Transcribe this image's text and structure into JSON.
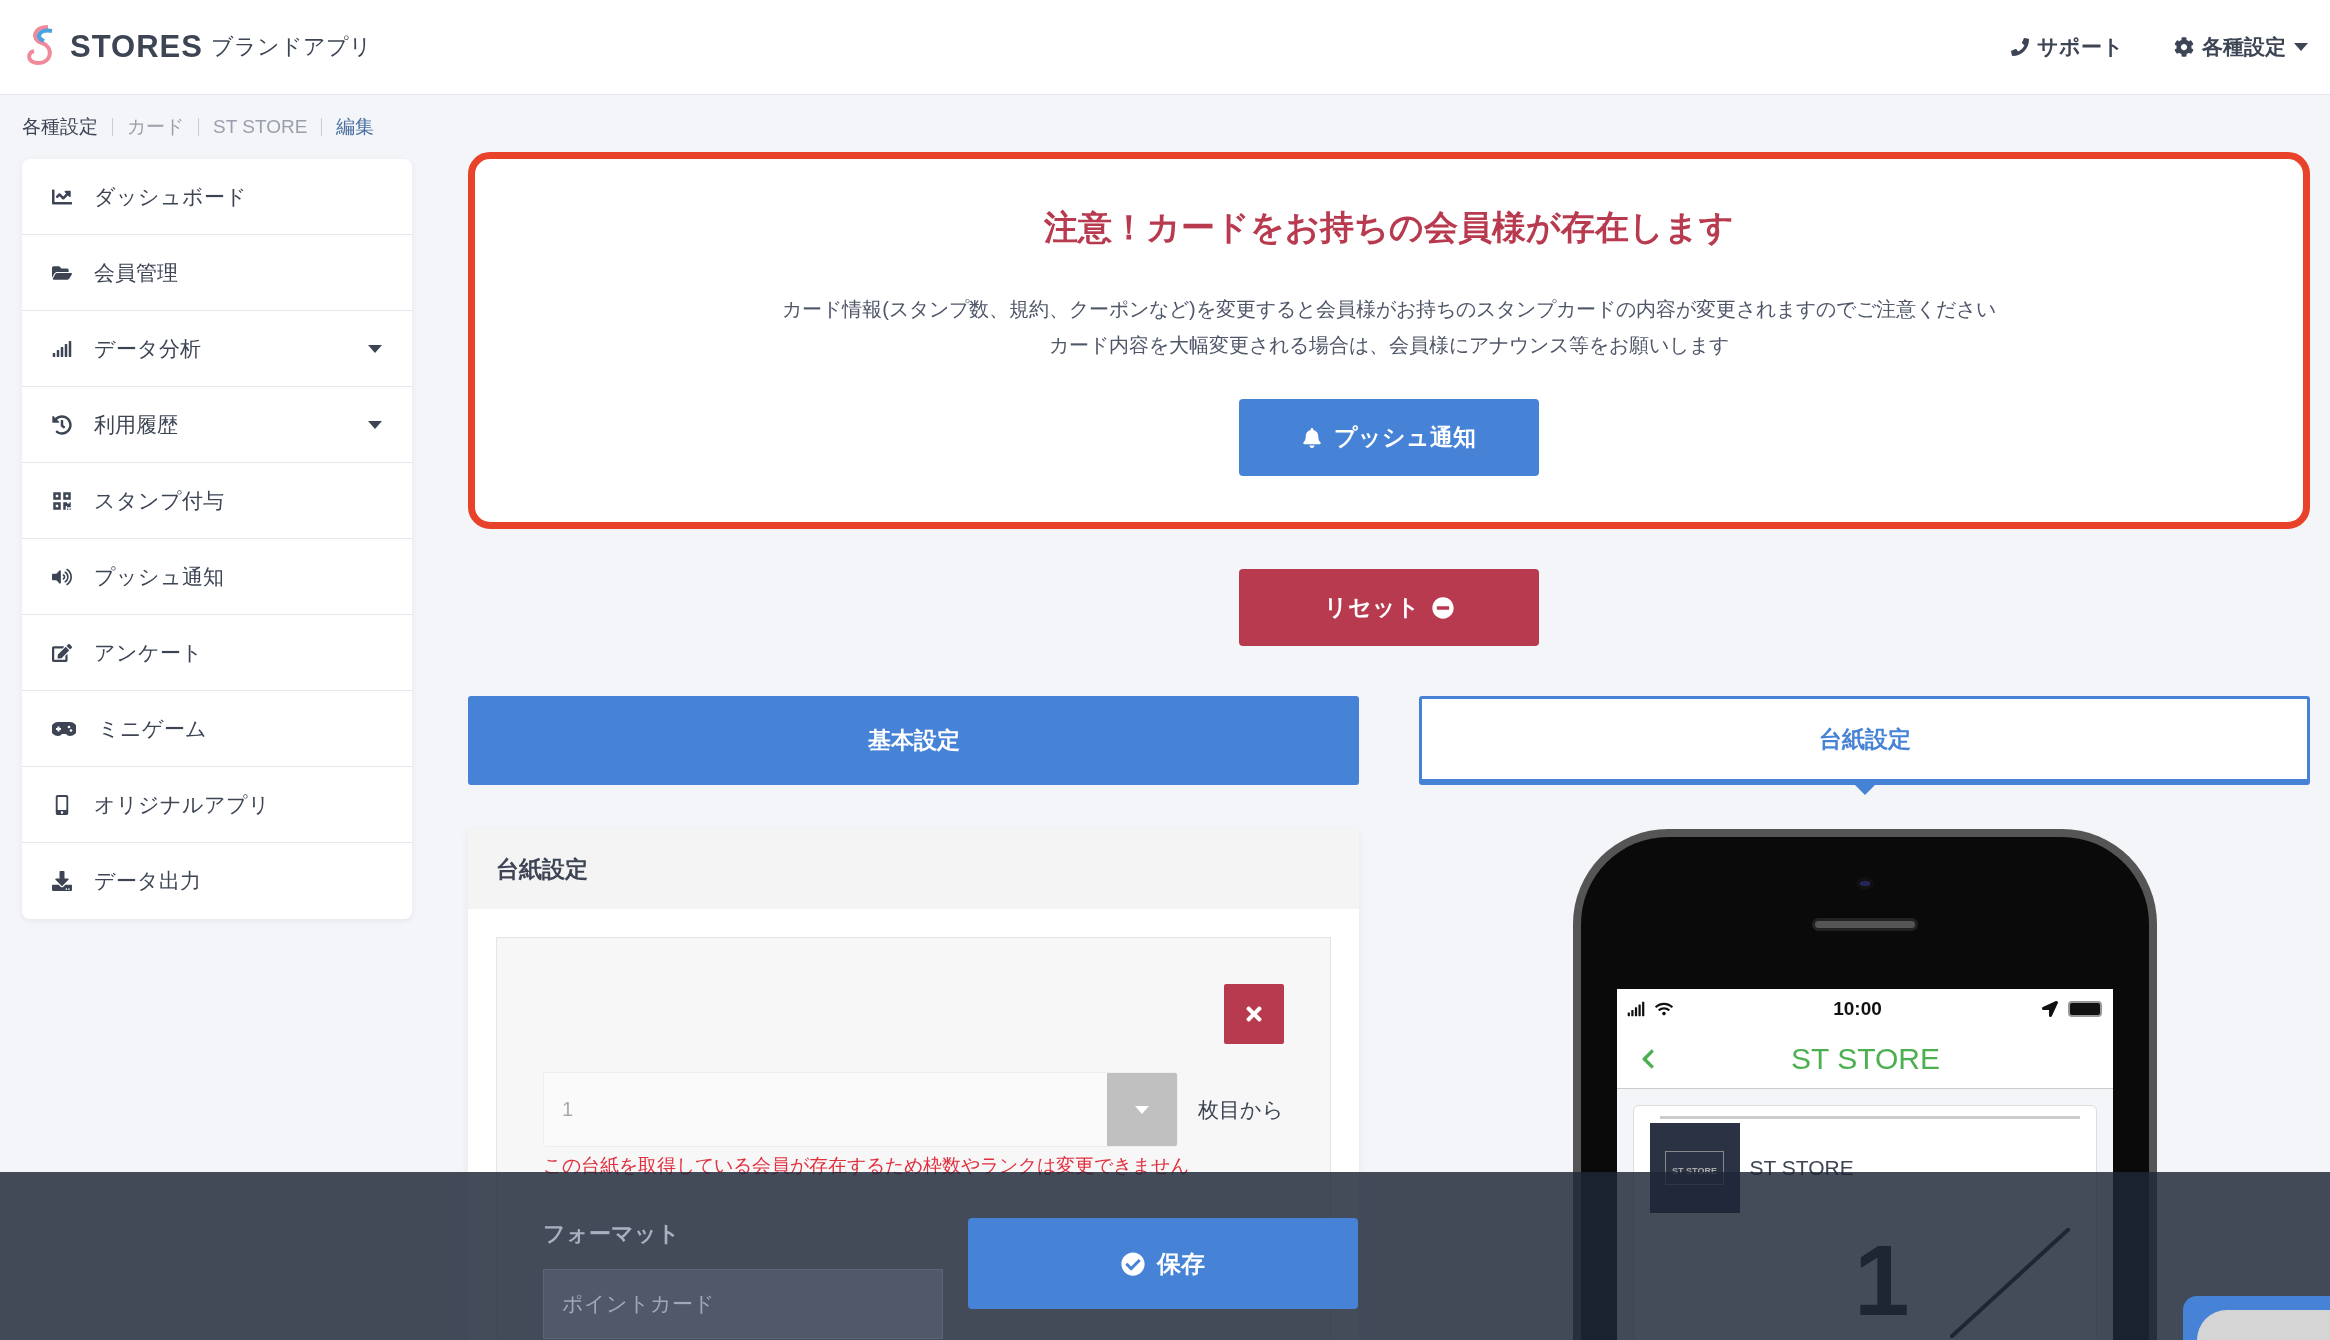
{
  "header": {
    "brand": "STORES",
    "brand_sub": "ブランドアプリ",
    "links": [
      {
        "label": "サポート",
        "kind": "support"
      },
      {
        "label": "各種設定",
        "kind": "settings"
      }
    ]
  },
  "breadcrumb": [
    {
      "label": "各種設定",
      "kind": "link"
    },
    {
      "label": "カード",
      "kind": "muted"
    },
    {
      "label": "ST STORE",
      "kind": "muted"
    },
    {
      "label": "編集",
      "kind": "current"
    }
  ],
  "sidebar": {
    "items": [
      {
        "label": "ダッシュボード",
        "expandable": false
      },
      {
        "label": "会員管理",
        "expandable": false
      },
      {
        "label": "データ分析",
        "expandable": true
      },
      {
        "label": "利用履歴",
        "expandable": true
      },
      {
        "label": "スタンプ付与",
        "expandable": false
      },
      {
        "label": "プッシュ通知",
        "expandable": false
      },
      {
        "label": "アンケート",
        "expandable": false
      },
      {
        "label": "ミニゲーム",
        "expandable": false
      },
      {
        "label": "オリジナルアプリ",
        "expandable": false
      },
      {
        "label": "データ出力",
        "expandable": false
      }
    ]
  },
  "alert": {
    "title": "注意！カードをお持ちの会員様が存在します",
    "lines": [
      "カード情報(スタンプ数、規約、クーポンなど)を変更すると会員様がお持ちのスタンプカードの内容が変更されますのでご注意ください",
      "カード内容を大幅変更される場合は、会員様にアナウンス等をお願いします"
    ],
    "button": "プッシュ通知"
  },
  "reset_button": "リセット",
  "tabs": [
    {
      "label": "基本設定",
      "selected": false
    },
    {
      "label": "台紙設定",
      "selected": true
    }
  ],
  "card": {
    "title": "台紙設定",
    "sheet_select": {
      "value": "1",
      "disabled": true
    },
    "sheet_suffix": "枚目から",
    "error": "この台紙を取得している会員が存在するため枠数やランクは変更できません",
    "format_label": "フォーマット",
    "format_value": "ポイントカード"
  },
  "phone": {
    "time": "10:00",
    "title": "ST STORE",
    "logo_text": "ST STORE",
    "store_name": "ST STORE",
    "stamp_count": "1"
  },
  "save_button": "保存"
}
